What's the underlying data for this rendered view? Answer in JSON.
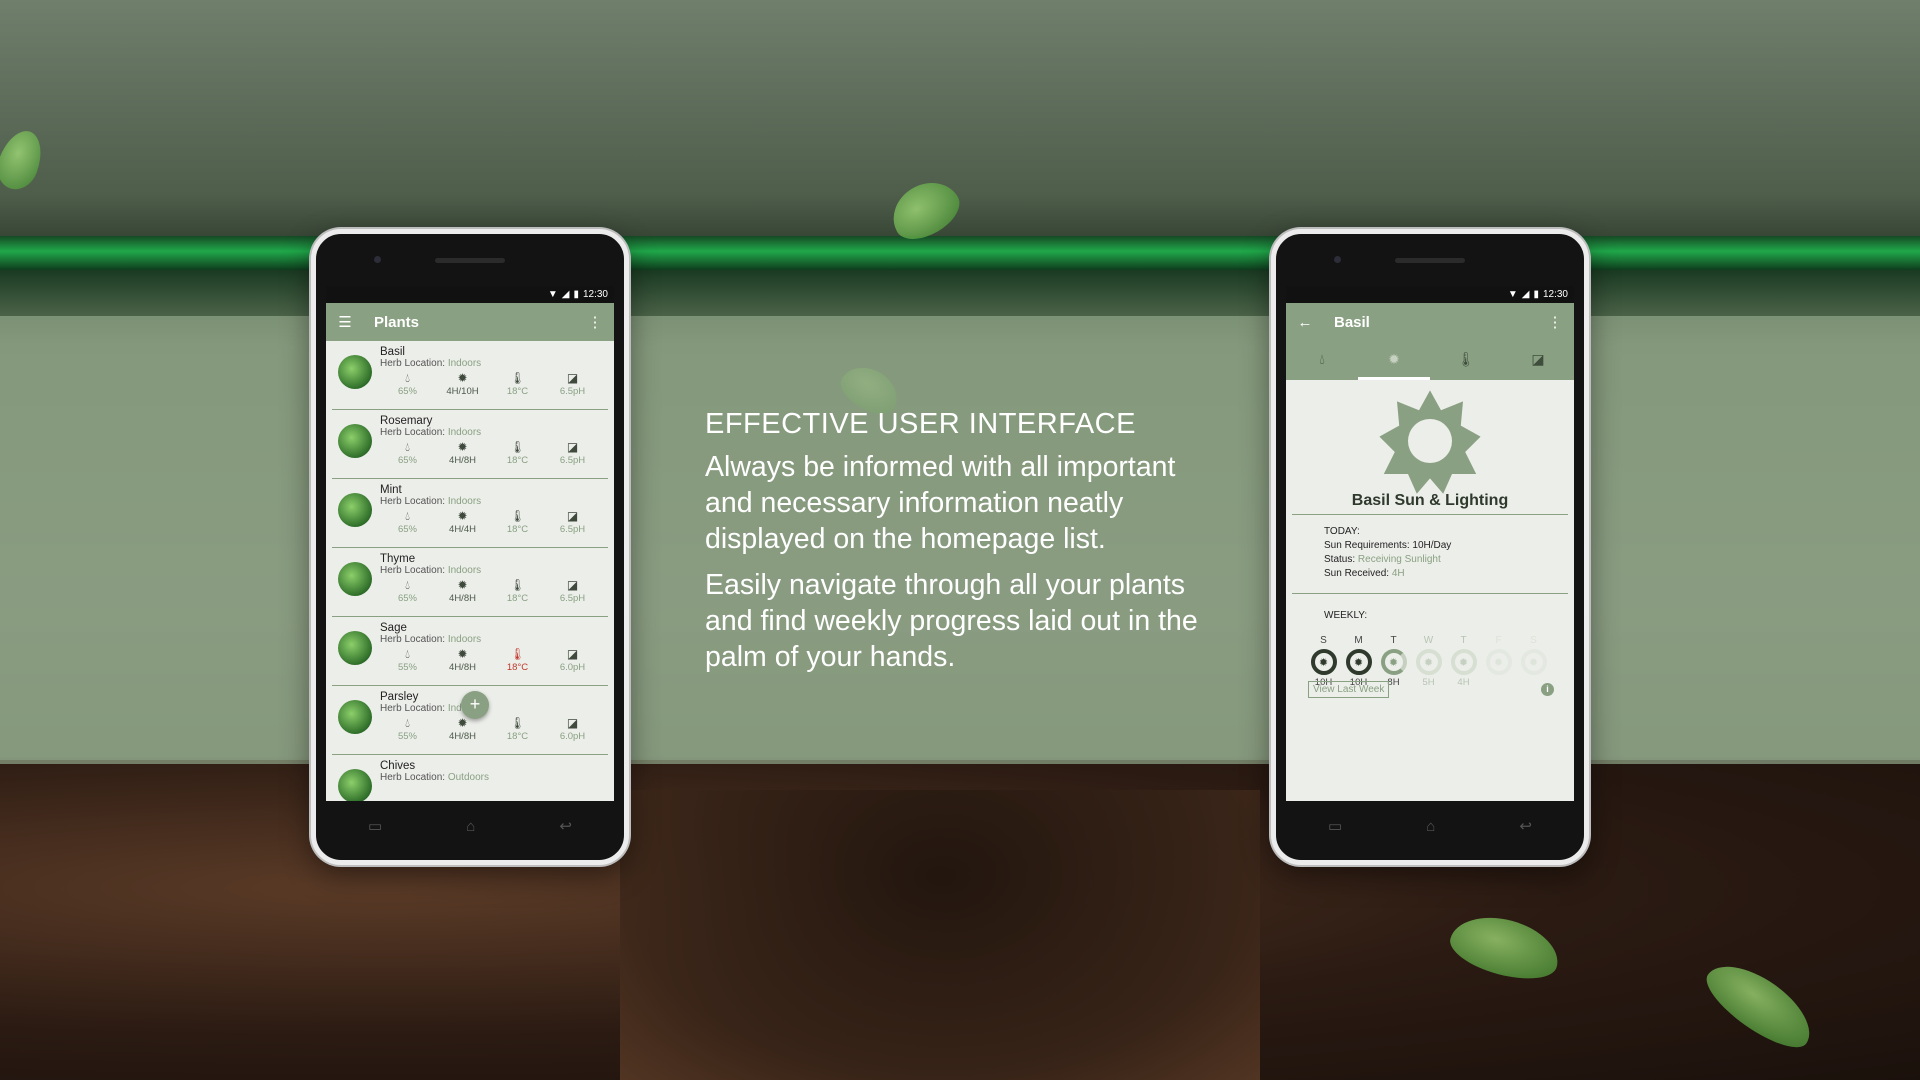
{
  "promo": {
    "heading": "EFFECTIVE USER INTERFACE",
    "paragraph1": "Always be informed with all important and necessary information neatly displayed on the homepage list.",
    "paragraph2": "Easily navigate through all your plants and find weekly progress laid out in the palm of your hands."
  },
  "status_bar": {
    "time": "12:30"
  },
  "list_screen": {
    "title": "Plants",
    "location_label": "Herb Location:",
    "plants": [
      {
        "name": "Basil",
        "location": "Indoors",
        "water": "65%",
        "sun": "4H/10H",
        "temp": "18°C",
        "ph": "6.5pH"
      },
      {
        "name": "Rosemary",
        "location": "Indoors",
        "water": "65%",
        "sun": "4H/8H",
        "temp": "18°C",
        "ph": "6.5pH"
      },
      {
        "name": "Mint",
        "location": "Indoors",
        "water": "65%",
        "sun": "4H/4H",
        "temp": "18°C",
        "ph": "6.5pH"
      },
      {
        "name": "Thyme",
        "location": "Indoors",
        "water": "65%",
        "sun": "4H/8H",
        "temp": "18°C",
        "ph": "6.5pH"
      },
      {
        "name": "Sage",
        "location": "Indoors",
        "water": "55%",
        "sun": "4H/8H",
        "temp": "18°C",
        "ph": "6.0pH"
      },
      {
        "name": "Parsley",
        "location": "Indoors",
        "water": "55%",
        "sun": "4H/8H",
        "temp": "18°C",
        "ph": "6.0pH"
      },
      {
        "name": "Chives",
        "location": "Outdoors"
      }
    ],
    "fab_label": "+"
  },
  "detail_screen": {
    "title": "Basil",
    "section_title": "Basil Sun & Lighting",
    "today_label": "TODAY:",
    "sun_requirements_label": "Sun Requirements:",
    "sun_requirements_value": "10H/Day",
    "status_label": "Status:",
    "status_value": "Receiving Sunlight",
    "sun_received_label": "Sun Received:",
    "sun_received_value": "4H",
    "weekly_label": "WEEKLY:",
    "days": [
      {
        "day": "S",
        "hours": "10H"
      },
      {
        "day": "M",
        "hours": "10H"
      },
      {
        "day": "T",
        "hours": "8H"
      },
      {
        "day": "W",
        "hours": "5H"
      },
      {
        "day": "T",
        "hours": "4H"
      },
      {
        "day": "F",
        "hours": ""
      },
      {
        "day": "S",
        "hours": ""
      }
    ],
    "view_last_week": "View Last Week",
    "info_label": "i"
  },
  "colors": {
    "accent": "#8aa082",
    "alert": "#c0392b",
    "screen_bg": "#eceeea"
  },
  "icons": [
    "menu-icon",
    "more-icon",
    "back-icon",
    "water-drop-icon",
    "sun-icon",
    "thermometer-icon",
    "ph-icon",
    "wifi-icon",
    "signal-icon",
    "battery-icon",
    "recent-apps-icon",
    "home-icon",
    "nav-back-icon",
    "info-icon"
  ]
}
